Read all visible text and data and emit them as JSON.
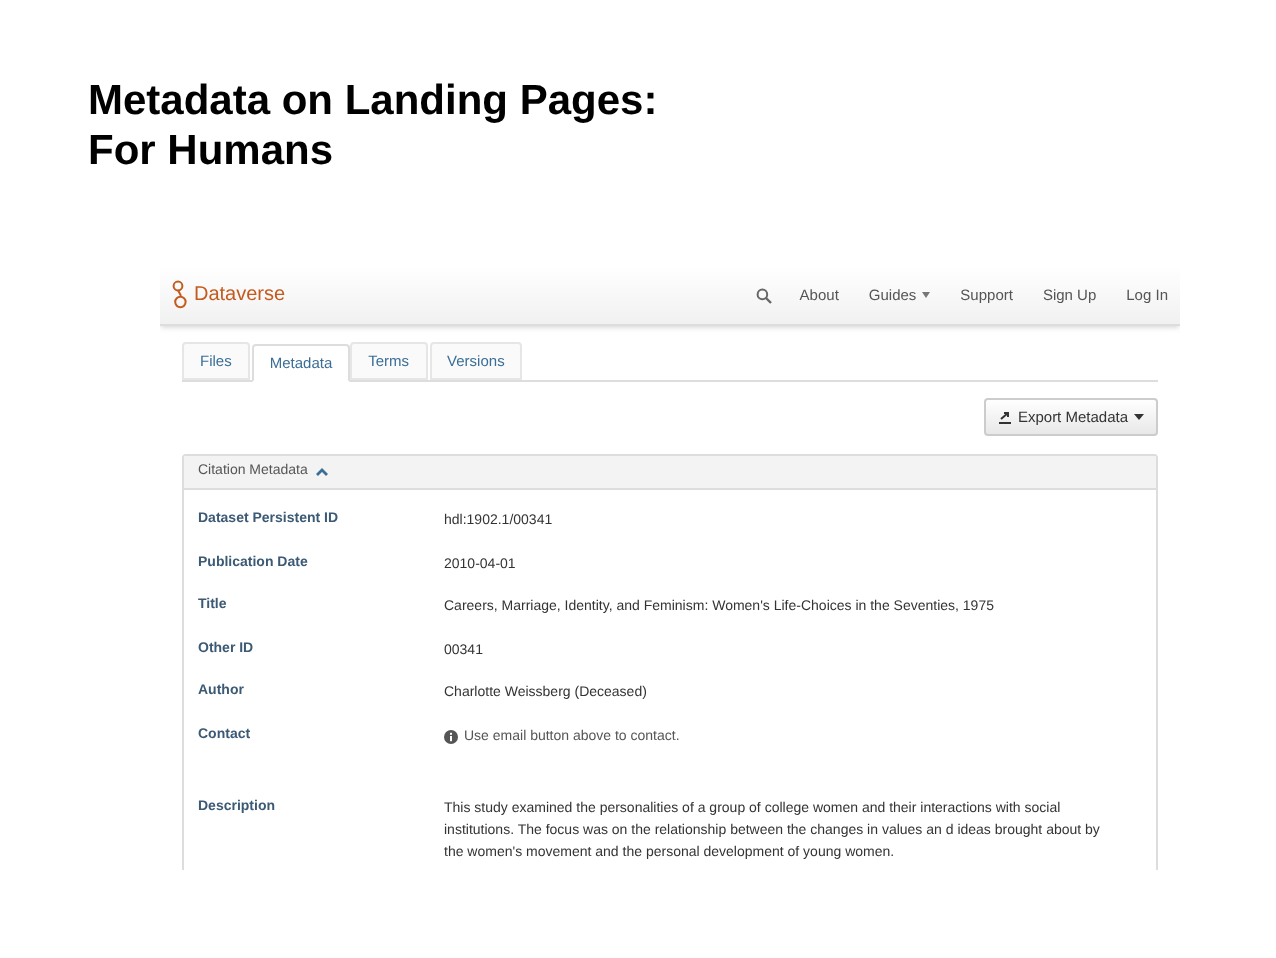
{
  "slide_title": "Metadata on Landing Pages:\nFor Humans",
  "navbar": {
    "brand": "Dataverse",
    "links": [
      {
        "label": "About",
        "dropdown": false
      },
      {
        "label": "Guides",
        "dropdown": true
      },
      {
        "label": "Support",
        "dropdown": false
      },
      {
        "label": "Sign Up",
        "dropdown": false
      },
      {
        "label": "Log In",
        "dropdown": false
      }
    ]
  },
  "tabs": [
    {
      "label": "Files",
      "selected": false
    },
    {
      "label": "Metadata",
      "selected": true
    },
    {
      "label": "Terms",
      "selected": false
    },
    {
      "label": "Versions",
      "selected": false
    }
  ],
  "export_button": {
    "label": "Export Metadata"
  },
  "panel": {
    "title": "Citation Metadata",
    "expanded": true,
    "fields": [
      {
        "label": "Dataset Persistent ID",
        "value": "hdl:1902.1/00341",
        "kind": "text"
      },
      {
        "label": "Publication Date",
        "value": "2010-04-01",
        "kind": "text"
      },
      {
        "label": "Title",
        "value": "Careers, Marriage, Identity, and Feminism: Women's Life-Choices in the Seventies, 1975",
        "kind": "text"
      },
      {
        "label": "Other ID",
        "value": "00341",
        "kind": "text"
      },
      {
        "label": "Author",
        "value": "Charlotte Weissberg (Deceased)",
        "kind": "text"
      },
      {
        "label": "Contact",
        "value": "Use email button above to contact.",
        "kind": "info"
      },
      {
        "label": "Description",
        "value": "This study examined the personalities of a group of college women and their interactions with social institutions. The focus was on the relationship between the changes in values an d ideas brought about by the women's movement and the personal development of young women.",
        "kind": "text"
      }
    ]
  }
}
